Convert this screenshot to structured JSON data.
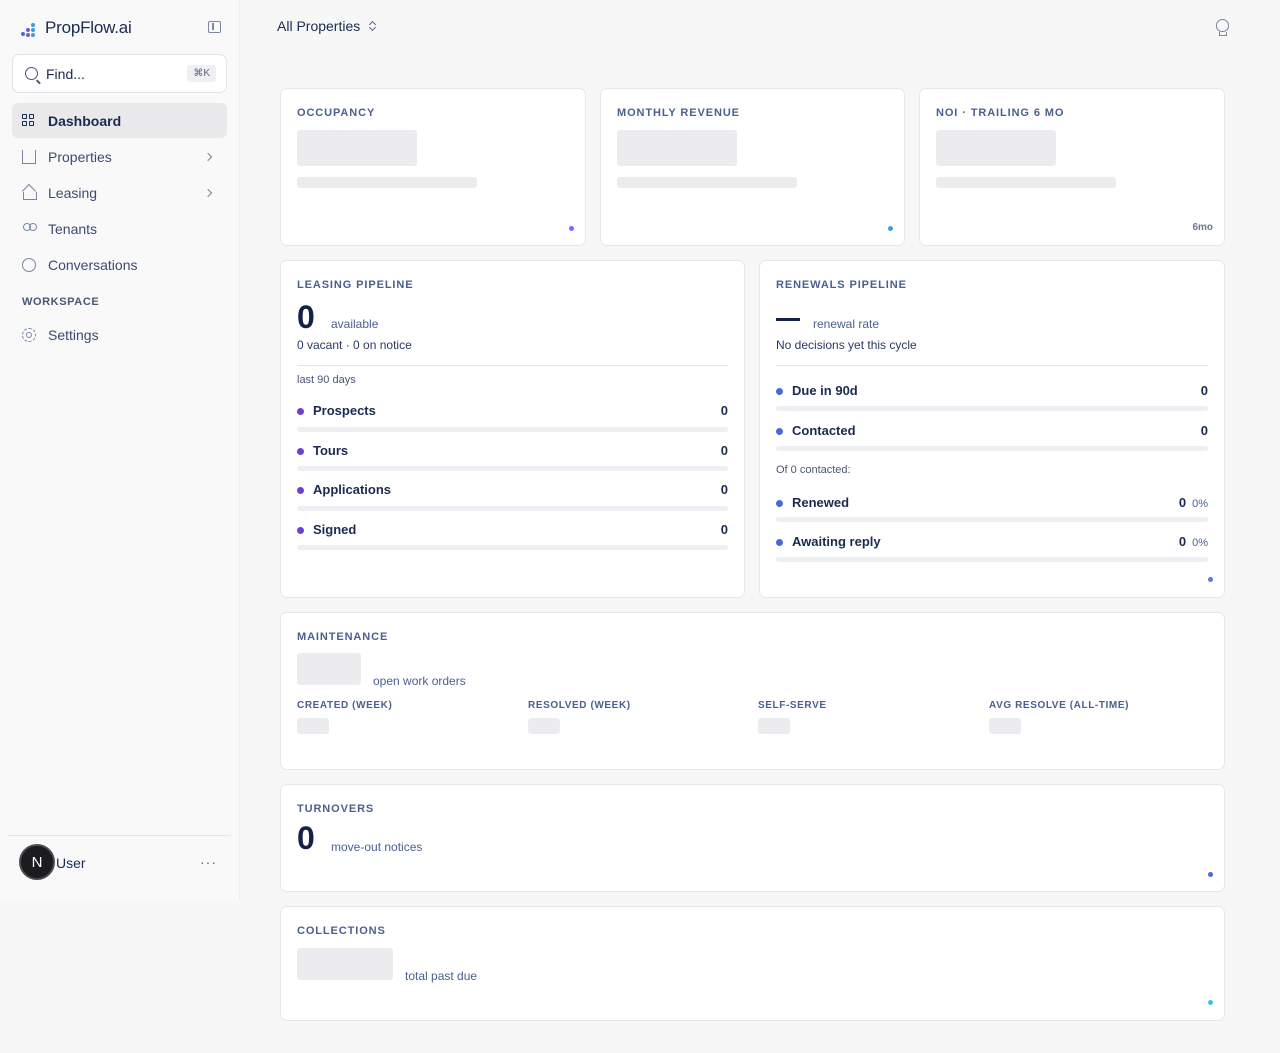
{
  "app": {
    "brand": "PropFlow.ai"
  },
  "sidebar": {
    "search_placeholder": "Find...",
    "search_shortcut": "⌘K",
    "items": [
      {
        "label": "Dashboard",
        "icon": "grid-icon",
        "active": true
      },
      {
        "label": "Properties",
        "icon": "building-icon",
        "has_children": true
      },
      {
        "label": "Leasing",
        "icon": "home-icon",
        "has_children": true
      },
      {
        "label": "Tenants",
        "icon": "users-icon"
      },
      {
        "label": "Conversations",
        "icon": "chat-icon"
      }
    ],
    "section_label": "WORKSPACE",
    "workspace_items": [
      {
        "label": "Settings",
        "icon": "gear-icon"
      }
    ],
    "user": {
      "avatar_initial": "N",
      "name": "User",
      "more": "···"
    }
  },
  "header": {
    "property_selector": "All Properties"
  },
  "cards": {
    "occupancy": {
      "title": "OCCUPANCY",
      "dot_color": "#8b5cf6"
    },
    "monthly_revenue": {
      "title": "MONTHLY REVENUE",
      "dot_color": "#3b9ee0"
    },
    "noi": {
      "title": "NOI · TRAILING 6 MO",
      "corner_label": "6mo"
    },
    "leasing_pipeline": {
      "title": "LEASING PIPELINE",
      "value": "0",
      "value_caption": "available",
      "subtitle": "0 vacant · 0 on notice",
      "period": "last 90 days",
      "dot_color": "#6d3fd6",
      "rows": [
        {
          "label": "Prospects",
          "value": "0"
        },
        {
          "label": "Tours",
          "value": "0"
        },
        {
          "label": "Applications",
          "value": "0"
        },
        {
          "label": "Signed",
          "value": "0"
        }
      ]
    },
    "renewals_pipeline": {
      "title": "RENEWALS PIPELINE",
      "value_caption": "renewal rate",
      "subtitle": "No decisions yet this cycle",
      "contacted_label": "Of 0 contacted:",
      "dot_color": "#4a6ad8",
      "rows_top": [
        {
          "label": "Due in 90d",
          "value": "0"
        },
        {
          "label": "Contacted",
          "value": "0"
        }
      ],
      "rows_bottom": [
        {
          "label": "Renewed",
          "value": "0",
          "pct": "0%"
        },
        {
          "label": "Awaiting reply",
          "value": "0",
          "pct": "0%"
        }
      ]
    },
    "maintenance": {
      "title": "MAINTENANCE",
      "value_caption": "open work orders",
      "stats": [
        {
          "label": "CREATED (WEEK)"
        },
        {
          "label": "RESOLVED (WEEK)"
        },
        {
          "label": "SELF-SERVE"
        },
        {
          "label": "AVG RESOLVE (ALL-TIME)"
        }
      ]
    },
    "turnovers": {
      "title": "TURNOVERS",
      "value": "0",
      "value_caption": "move-out notices",
      "dot_color": "#4a6ad8"
    },
    "collections": {
      "title": "COLLECTIONS",
      "value_caption": "total past due",
      "dot_color": "#38c5e0"
    }
  }
}
